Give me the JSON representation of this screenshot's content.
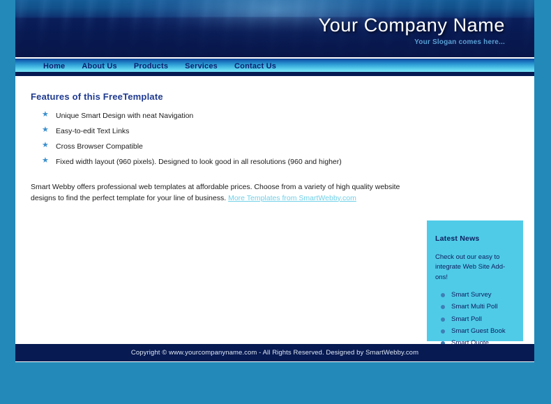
{
  "header": {
    "company_name": "Your Company Name",
    "slogan": "Your Slogan comes here..."
  },
  "nav": {
    "items": [
      {
        "label": "Home"
      },
      {
        "label": "About Us"
      },
      {
        "label": "Products"
      },
      {
        "label": "Services"
      },
      {
        "label": "Contact Us"
      }
    ]
  },
  "main": {
    "heading": "Features of this FreeTemplate",
    "features": [
      {
        "bullet": "★",
        "label": "Unique Smart Design with neat Navigation"
      },
      {
        "bullet": "★",
        "label": "Easy-to-edit Text Links"
      },
      {
        "bullet": "★",
        "label": "Cross Browser Compatible"
      },
      {
        "bullet": "★",
        "label": "Fixed width layout (960 pixels). Designed to look good in all resolutions (960 and higher)"
      }
    ],
    "paragraph": "Smart Webby offers professional web templates at affordable prices. Choose from a variety of high quality website designs to find the perfect template for your line of business. ",
    "link_label": "More Templates from SmartWebby.com"
  },
  "sidebar": {
    "heading": "Latest News",
    "text": "Check out our easy to integrate Web Site Add-ons!",
    "items": [
      {
        "label": "Smart Survey"
      },
      {
        "label": "Smart Multi Poll"
      },
      {
        "label": "Smart Poll"
      },
      {
        "label": "Smart Guest Book"
      },
      {
        "label": "Smart Quote"
      }
    ]
  },
  "footer": {
    "text": "Copyright © www.yourcompanyname.com - All Rights Reserved. Designed by SmartWebby.com"
  },
  "colors": {
    "page_background": "#2389b8",
    "header_navy": "#0a1f5c",
    "nav_cyan": "#5fd4ef",
    "sidebar_cyan": "#4fcbe8",
    "footer_navy": "#071a52",
    "heading_blue": "#1f3a8f",
    "link_cyan": "#6fd0e8"
  }
}
